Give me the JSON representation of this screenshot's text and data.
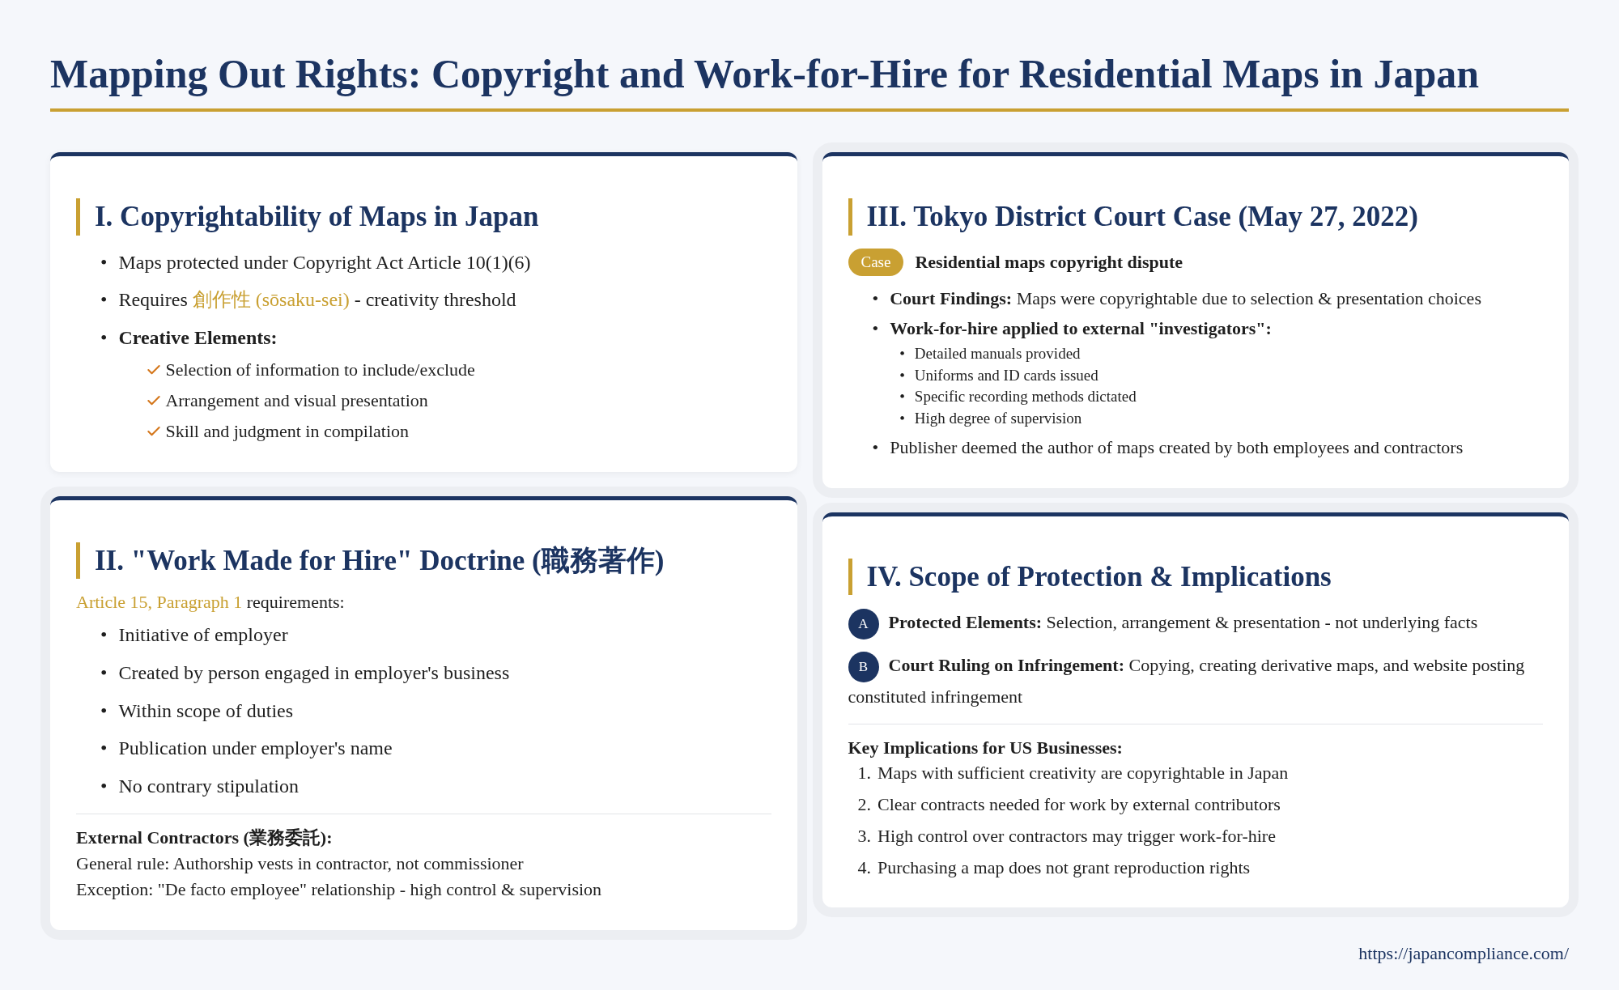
{
  "title": "Mapping Out Rights: Copyright and Work-for-Hire for Residential Maps in Japan",
  "columns": [
    [
      {
        "heading": "I. Copyrightability of Maps in Japan",
        "bullets": [
          {
            "mark": "•",
            "text": "Maps protected under Copyright Act Article 10(1)(6)"
          },
          {
            "mark": "•",
            "text": "Requires ",
            "highlight": "創作性 (sōsaku-sei)",
            "after": " - creativity threshold"
          },
          {
            "mark": "•",
            "text": "Creative Elements:",
            "bold": true,
            "checklist": [
              "Selection of information to include/exclude",
              "Arrangement and visual presentation",
              "Skill and judgment in compilation"
            ]
          }
        ]
      },
      {
        "heading": "II. \"Work Made for Hire\" Doctrine (職務著作)",
        "intro": {
          "highlight": "Article 15, Paragraph 1",
          "text": " requirements:"
        },
        "bullets": [
          {
            "mark": "•",
            "text": "Initiative of employer"
          },
          {
            "mark": "•",
            "text": "Created by person engaged in employer's business"
          },
          {
            "mark": "•",
            "text": "Within scope of duties"
          },
          {
            "mark": "•",
            "text": "Publication under employer's name"
          },
          {
            "mark": "•",
            "text": "No contrary stipulation"
          }
        ],
        "note": {
          "title": "External Contractors (業務委託):",
          "lines": [
            "General rule: Authorship vests in contractor, not commissioner",
            "Exception: \"De facto employee\" relationship - high control & supervision"
          ]
        }
      }
    ],
    [
      {
        "heading": "III. Tokyo District Court Case (May 27, 2022)",
        "badge": "Case",
        "case_title": "Residential maps copyright dispute",
        "bullets": [
          {
            "mark": "•",
            "text": "**Court Findings:** Maps were copyrightable due to selection & presentation choices"
          },
          {
            "mark": "•",
            "text": "Work-for-hire applied to external \"investigators\":",
            "bold": true,
            "sub": [
              {
                "mark": "•",
                "text": "Detailed manuals provided"
              },
              {
                "mark": "•",
                "text": "Uniforms and ID cards issued"
              },
              {
                "mark": "•",
                "text": "Specific recording methods dictated"
              },
              {
                "mark": "•",
                "text": "High degree of supervision"
              }
            ]
          },
          {
            "mark": "•",
            "text": "Publisher deemed the author of maps created by both employees and contractors"
          }
        ]
      },
      {
        "heading": "IV. Scope of Protection & Implications",
        "markers": [
          {
            "letter": "A",
            "text": "**Protected Elements:** Selection, arrangement & presentation - not underlying facts"
          },
          {
            "letter": "B",
            "text": "**Court Ruling on Infringement:** Copying, creating derivative maps, and website posting constituted infringement"
          }
        ],
        "implications": {
          "title": "Key Implications for US Businesses:",
          "items": [
            {
              "number": "1.",
              "text": "Maps with sufficient creativity are copyrightable in Japan"
            },
            {
              "number": "2.",
              "text": "Clear contracts needed for work by external contributors"
            },
            {
              "number": "3.",
              "text": "High control over contractors may trigger work-for-hire"
            },
            {
              "number": "4.",
              "text": "Purchasing a map does not grant reproduction rights"
            }
          ]
        }
      }
    ]
  ],
  "url": "https://japancompliance.com/"
}
